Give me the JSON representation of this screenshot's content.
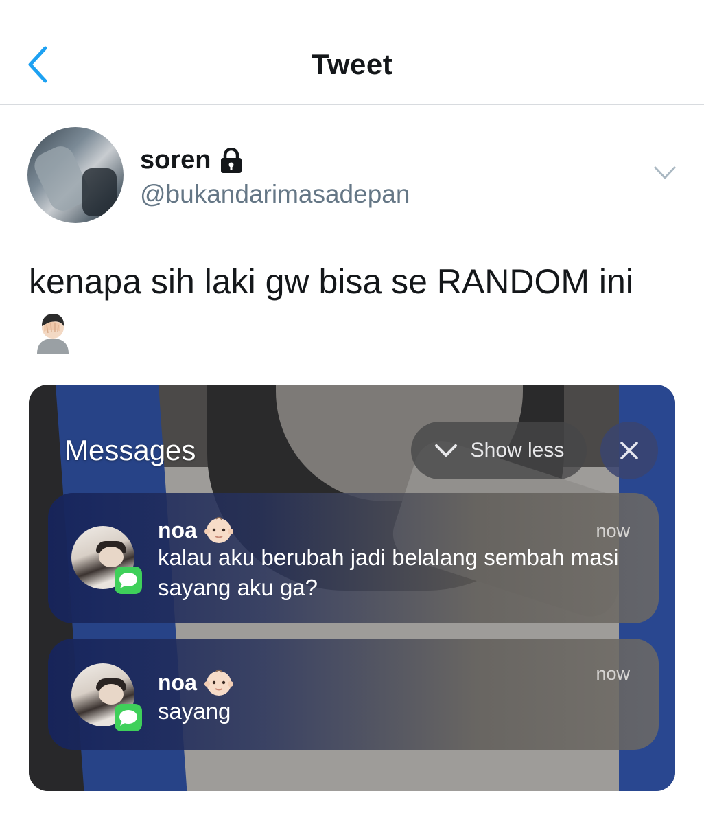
{
  "nav": {
    "title": "Tweet",
    "back_icon": "chevron-left-icon",
    "accent": "#1da1f2"
  },
  "author": {
    "name": "soren",
    "handle": "@bukandarimasadepan",
    "protected_icon": "lock-icon",
    "menu_icon": "chevron-down-icon"
  },
  "tweet": {
    "text": "kenapa sih laki gw bisa se RANDOM ini",
    "emoji": "facepalm-icon"
  },
  "media": {
    "heading": "Messages",
    "show_less_label": "Show less",
    "close_icon": "close-icon",
    "notifications": [
      {
        "sender": "noa",
        "sender_emoji": "baby-icon",
        "time": "now",
        "message": "kalau aku berubah jadi belalang sembah masi sayang aku ga?",
        "app_icon": "imessage-icon"
      },
      {
        "sender": "noa",
        "sender_emoji": "baby-icon",
        "time": "now",
        "message": "sayang",
        "app_icon": "imessage-icon"
      }
    ]
  }
}
